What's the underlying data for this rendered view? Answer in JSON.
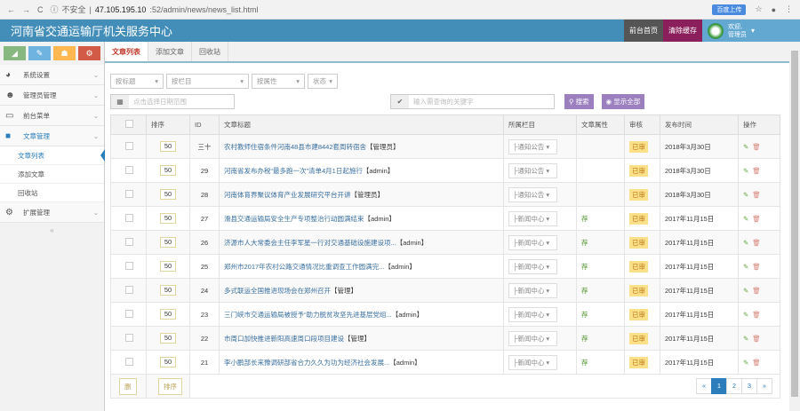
{
  "browser": {
    "insecure": "不安全",
    "url_host": "47.105.195.10",
    "url_path": ":52/admin/news/news_list.html",
    "upload": "百度上传"
  },
  "header": {
    "title": "河南省交通运输厅机关服务中心",
    "home": "前台首页",
    "clear_cache": "清除缓存",
    "welcome": "欢迎,",
    "user": "管理员"
  },
  "sidebar": {
    "items": [
      {
        "label": "系统设置",
        "icon": "dashboard-icon"
      },
      {
        "label": "管理员管理",
        "icon": "users-icon"
      },
      {
        "label": "前台菜单",
        "icon": "desktop-icon"
      },
      {
        "label": "文章管理",
        "icon": "folder-icon"
      },
      {
        "label": "扩展管理",
        "icon": "cogs-icon"
      }
    ],
    "sub": [
      "文章列表",
      "添加文章",
      "回收站"
    ]
  },
  "tabs": [
    "文章列表",
    "添加文章",
    "回收站"
  ],
  "filters": {
    "by_title": "按标题",
    "by_column": "按栏目",
    "by_attr": "按属性",
    "status": "状态",
    "date_placeholder": "点击选择日期范围",
    "keyword_placeholder": "输入需查询的关键字",
    "search": "搜索",
    "show_all": "显示全部"
  },
  "table": {
    "headers": [
      "排序",
      "ID",
      "文章标题",
      "所属栏目",
      "文章属性",
      "审核",
      "发布时间",
      "操作"
    ],
    "rows": [
      {
        "sort": "50",
        "id": "三十",
        "title": "农村教师住宿条件河南48县市建8442套周转宿舍",
        "author": "【管理员】",
        "cat": "├通知公告",
        "attr": "",
        "audit": "已审",
        "date": "2018年3月30日"
      },
      {
        "sort": "50",
        "id": "29",
        "title": "河南省发布办税“最多跑一次”清单4月1日起施行",
        "author": "【admin】",
        "cat": "├通知公告",
        "attr": "",
        "audit": "已审",
        "date": "2018年3月30日"
      },
      {
        "sort": "50",
        "id": "28",
        "title": "河南体育界聚议体育产业发展研究平台开讲",
        "author": "【管理员】",
        "cat": "├通知公告",
        "attr": "",
        "audit": "已审",
        "date": "2018年3月30日"
      },
      {
        "sort": "50",
        "id": "27",
        "title": "滑县交通运输局安全生产专项整治行动圆满结束",
        "author": "【admin】",
        "cat": "├新闻中心",
        "attr": "荐",
        "audit": "已审",
        "date": "2017年11月15日"
      },
      {
        "sort": "50",
        "id": "26",
        "title": "济源市人大常委会主任李军星一行对交通基础设施建设项...",
        "author": "【admin】",
        "cat": "├新闻中心",
        "attr": "荐",
        "audit": "已审",
        "date": "2017年11月15日"
      },
      {
        "sort": "50",
        "id": "25",
        "title": "郑州市2017年农村公路交通情况比重调查工作圆满完...",
        "author": "【admin】",
        "cat": "├新闻中心",
        "attr": "荐",
        "audit": "已审",
        "date": "2017年11月15日"
      },
      {
        "sort": "50",
        "id": "24",
        "title": "多式联运全国推进现场会在郑州召开",
        "author": "【管理】",
        "cat": "├新闻中心",
        "attr": "荐",
        "audit": "已审",
        "date": "2017年11月15日"
      },
      {
        "sort": "50",
        "id": "23",
        "title": "三门峡市交通运输局被授予“助力脱贫攻坚先进基层党组...",
        "author": "【admin】",
        "cat": "├新闻中心",
        "attr": "荐",
        "audit": "已审",
        "date": "2017年11月15日"
      },
      {
        "sort": "50",
        "id": "22",
        "title": "市周口加快推进新阳高速周口段项目建设",
        "author": "【管理】",
        "cat": "├新闻中心",
        "attr": "荐",
        "audit": "已审",
        "date": "2017年11月15日"
      },
      {
        "sort": "50",
        "id": "21",
        "title": "李小鹏部长来豫调研部省合力久久为功为经济社会发展...",
        "author": "【admin】",
        "cat": "├新闻中心",
        "attr": "荐",
        "audit": "已审",
        "date": "2017年11月15日"
      }
    ],
    "delete_btn": "删",
    "sort_btn": "排序"
  },
  "pagination": {
    "prev": "«",
    "pages": [
      "1",
      "2",
      "3"
    ],
    "current": "1",
    "next": "»"
  }
}
